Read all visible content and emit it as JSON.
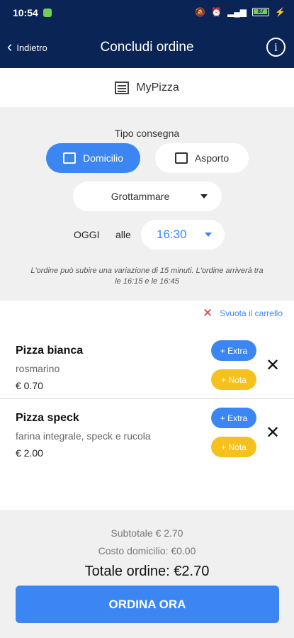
{
  "status_bar": {
    "time": "10:54",
    "battery": "87"
  },
  "header": {
    "back_label": "Indietro",
    "title": "Concludi ordine"
  },
  "shop": {
    "name": "MyPizza"
  },
  "delivery": {
    "type_label": "Tipo consegna",
    "option_home": "Domicilio",
    "option_takeaway": "Asporto",
    "city": "Grottammare",
    "day": "OGGI",
    "at_label": "alle",
    "time": "16:30",
    "note": "L'ordine può subire una variazione di 15 minuti. L'ordine arriverà tra le 16:15 e le 16:45"
  },
  "cart": {
    "clear_label": "Svuota il carrello",
    "items": [
      {
        "name": "Pizza bianca",
        "desc": "rosmarino",
        "price": "€ 0.70",
        "extra": "+ Extra",
        "nota": "+ Nota"
      },
      {
        "name": "Pizza speck",
        "desc": "farina integrale, speck e rucola",
        "price": "€ 2.00",
        "extra": "+ Extra",
        "nota": "+ Nota"
      }
    ]
  },
  "summary": {
    "subtotal": "Subtotale € 2.70",
    "delivery_cost": "Costo domicilio: €0.00",
    "total": "Totale ordine: €2.70",
    "order_button": "ORDINA ORA"
  },
  "colors": {
    "primary": "#3b86f2",
    "navy": "#0a2456",
    "yellow": "#f5c11e",
    "danger": "#e03a3a"
  }
}
